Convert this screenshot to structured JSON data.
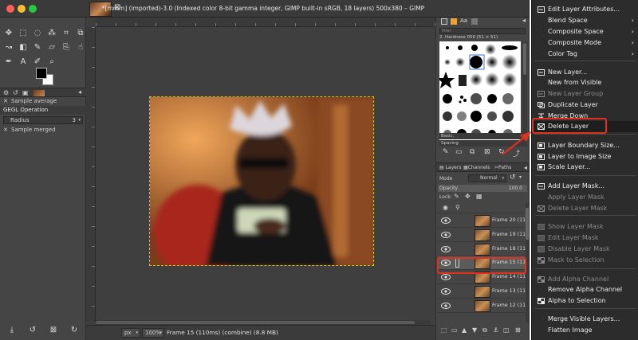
{
  "window": {
    "title": "*[mmm] (imported)-3.0 (Indexed color 8-bit gamma integer, GIMP built-in sRGB, 18 layers) 500x380 – GIMP",
    "traffic_colors": [
      "#fe5f57",
      "#febc2e",
      "#28c840"
    ]
  },
  "tool_options": {
    "sample_average": "Sample average",
    "operation": "GEGL Operation",
    "radius_label": "Radius",
    "radius_value": "3",
    "sample_merged": "Sample merged"
  },
  "status": {
    "unit": "px",
    "zoom": "100%",
    "info": "Frame 15 (110ms) (combine) (8.8 MB)"
  },
  "brushes": {
    "filter_placeholder": "filter",
    "current": "2. Hardness 050 (51 × 51)",
    "preset": "Basic,",
    "spacing_label": "Spacing"
  },
  "layers_panel": {
    "tabs": [
      "Layers",
      "Channels",
      "Paths"
    ],
    "mode_label": "Mode",
    "mode_value": "Normal",
    "opacity_label": "Opacity",
    "opacity_value": "100.0",
    "lock_label": "Lock:",
    "layers": [
      {
        "name": "Frame 20 (110"
      },
      {
        "name": "Frame 19 (110"
      },
      {
        "name": "Frame 18 (110"
      },
      {
        "name": "Frame 15 (110"
      },
      {
        "name": "Frame 14 (110"
      },
      {
        "name": "Frame 13 (110"
      },
      {
        "name": "Frame 12 (110"
      }
    ]
  },
  "context_menu": {
    "items": [
      {
        "label": "Edit Layer Attributes...",
        "enabled": true,
        "icon": "edit-icon"
      },
      {
        "label": "Blend Space",
        "enabled": true,
        "submenu": true
      },
      {
        "label": "Composite Space",
        "enabled": true,
        "submenu": true
      },
      {
        "label": "Composite Mode",
        "enabled": true,
        "submenu": true
      },
      {
        "label": "Color Tag",
        "enabled": true,
        "submenu": true
      },
      {
        "label": "New Layer...",
        "enabled": true,
        "icon": "new-layer-icon"
      },
      {
        "label": "New from Visible",
        "enabled": true
      },
      {
        "label": "New Layer Group",
        "enabled": false,
        "icon": "layer-group-icon"
      },
      {
        "label": "Duplicate Layer",
        "enabled": true,
        "icon": "duplicate-icon"
      },
      {
        "label": "Merge Down",
        "enabled": true,
        "icon": "merge-down-icon"
      },
      {
        "label": "Delete Layer",
        "enabled": true,
        "icon": "delete-icon"
      },
      {
        "label": "Layer Boundary Size...",
        "enabled": true,
        "icon": "boundary-icon"
      },
      {
        "label": "Layer to Image Size",
        "enabled": true,
        "icon": "to-image-size-icon"
      },
      {
        "label": "Scale Layer...",
        "enabled": true,
        "icon": "scale-icon"
      },
      {
        "label": "Add Layer Mask...",
        "enabled": true,
        "icon": "add-mask-icon"
      },
      {
        "label": "Apply Layer Mask",
        "enabled": false
      },
      {
        "label": "Delete Layer Mask",
        "enabled": false,
        "icon": "delete-mask-icon"
      },
      {
        "label": "Show Layer Mask",
        "enabled": false,
        "icon": "checkbox-icon"
      },
      {
        "label": "Edit Layer Mask",
        "enabled": false,
        "icon": "checkbox-icon"
      },
      {
        "label": "Disable Layer Mask",
        "enabled": false,
        "icon": "checkbox-icon"
      },
      {
        "label": "Mask to Selection",
        "enabled": false,
        "icon": "mask-selection-icon"
      },
      {
        "label": "Add Alpha Channel",
        "enabled": false,
        "icon": "alpha-icon"
      },
      {
        "label": "Remove Alpha Channel",
        "enabled": true
      },
      {
        "label": "Alpha to Selection",
        "enabled": true,
        "icon": "alpha-selection-icon"
      },
      {
        "label": "Merge Visible Layers...",
        "enabled": true
      },
      {
        "label": "Flatten Image",
        "enabled": true
      }
    ]
  },
  "highlight_color": "#e0301e"
}
